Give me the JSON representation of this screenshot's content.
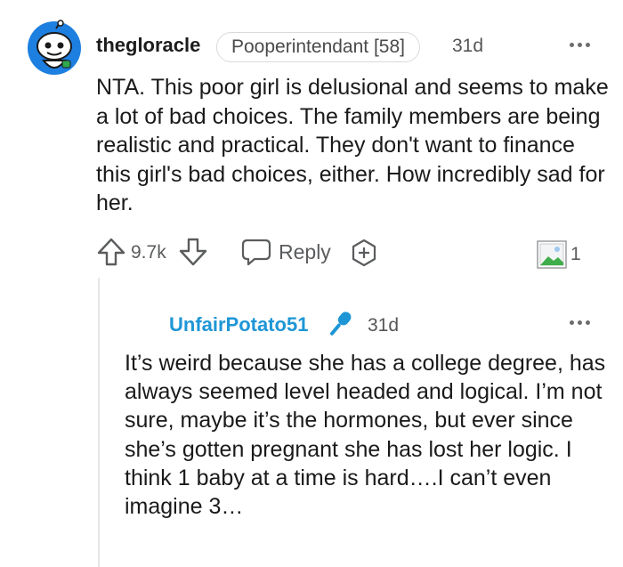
{
  "comment": {
    "username": "thegloracle",
    "flair": "Pooperintendant [58]",
    "age": "31d",
    "body": "NTA. This poor girl is delusional and seems to make a lot of bad choices. The family members are being realistic and practical. They don't want to finance this girl's bad choices, either. How incredibly sad for her.",
    "votes": "9.7k",
    "reply_label": "Reply",
    "award_count": "1"
  },
  "reply": {
    "username": "UnfairPotato51",
    "age": "31d",
    "body": "It’s weird because she has a college degree, has always seemed level headed and logical. I’m not sure, maybe it’s the hormones, but ever since she’s gotten pregnant she has lost her logic. I think 1 baby at a time is hard….I can’t even imagine 3…"
  },
  "icons": {
    "avatar": "snoo-avatar-icon",
    "upvote": "upvote-arrow-icon",
    "downvote": "downvote-arrow-icon",
    "reply": "speech-bubble-icon",
    "award": "award-plus-icon",
    "image": "image-award-icon",
    "more": "more-options-icon",
    "mic": "microphone-icon"
  },
  "colors": {
    "reply_username": "#1e96d6",
    "avatar_bg": "#1d7fe0",
    "thread_line": "#e4e6e8"
  }
}
